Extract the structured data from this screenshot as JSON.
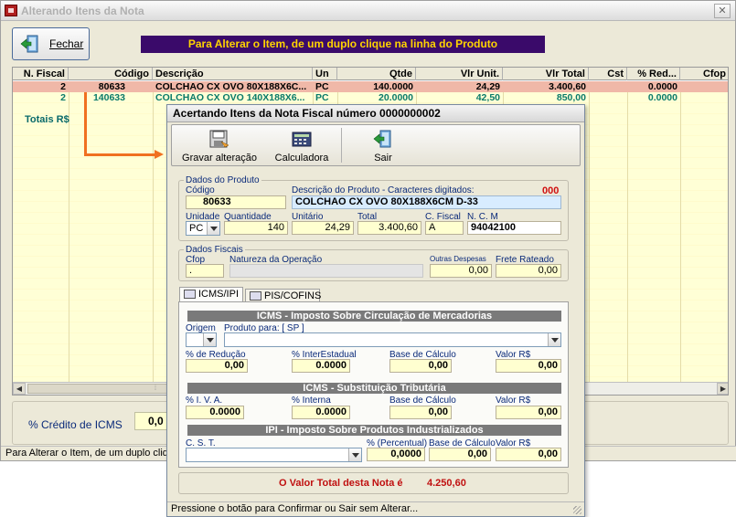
{
  "window": {
    "title": "Alterando Itens da Nota",
    "close_label": "✕"
  },
  "toolbar": {
    "fechar_label": "Fechar"
  },
  "banner": "Para Alterar o Item, de um duplo clique na linha do Produto",
  "grid": {
    "columns": [
      "N. Fiscal",
      "Código",
      "Descrição",
      "Un",
      "Qtde",
      "Vlr Unit.",
      "Vlr Total",
      "Cst",
      "% Red...",
      "Cfop"
    ],
    "rows": [
      [
        "2",
        "80633",
        "COLCHAO CX OVO 80X188X6C...",
        "PC",
        "140.0000",
        "24,29",
        "3.400,60",
        "",
        "0.0000",
        ""
      ],
      [
        "2",
        "140633",
        "COLCHAO CX OVO 140X188X6...",
        "PC",
        "20.0000",
        "42,50",
        "850,00",
        "",
        "0.0000",
        ""
      ]
    ],
    "totais_label": "Totais R$"
  },
  "credito": {
    "label": "% Crédito de ICMS",
    "value": "0,0"
  },
  "statusbar": "Para Alterar o Item, de um duplo cliq",
  "dialog": {
    "title": "Acertando Itens da Nota Fiscal número 0000000002",
    "buttons": {
      "gravar": "Gravar alteração",
      "calculadora": "Calculadora",
      "sair": "Sair"
    },
    "dados_produto": {
      "title": "Dados do Produto",
      "codigo_label": "Código",
      "codigo": "80633",
      "descricao_label": "Descrição do Produto -  Caracteres digitados:",
      "caracteres": "000",
      "descricao": "COLCHAO CX OVO 80X188X6CM D-33",
      "unidade_label": "Unidade",
      "unidade": "PC",
      "quantidade_label": "Quantidade",
      "quantidade": "140",
      "unitario_label": "Unitário",
      "unitario": "24,29",
      "total_label": "Total",
      "total": "3.400,60",
      "cfiscal_label": "C. Fiscal",
      "cfiscal": "A",
      "ncm_label": "N. C. M",
      "ncm": "94042100"
    },
    "dados_fiscais": {
      "title": "Dados Fiscais",
      "cfop_label": "Cfop",
      "cfop": ".",
      "natureza_label": "Natureza da Operação",
      "natureza": "",
      "outras_label": "Outras Despesas",
      "outras": "0,00",
      "frete_label": "Frete Rateado",
      "frete": "0,00"
    },
    "tabs": [
      "ICMS/IPI",
      "PIS/COFINS"
    ],
    "icms": {
      "title": "ICMS - Imposto Sobre Circulação de Mercadorias",
      "origem_label": "Origem",
      "origem": "",
      "produto_para_label": "Produto para: [ SP ]",
      "produto_para": "",
      "reducao_label": "% de Redução",
      "reducao": "0,00",
      "interestadual_label": "% InterEstadual",
      "interestadual": "0.0000",
      "base_label": "Base de Cálculo",
      "base": "0,00",
      "valor_label": "Valor R$",
      "valor": "0,00"
    },
    "st": {
      "title": "ICMS - Substituição Tributária",
      "iva_label": "% I. V. A.",
      "iva": "0.0000",
      "interna_label": "% Interna",
      "interna": "0.0000",
      "base_label": "Base de Cálculo",
      "base": "0,00",
      "valor_label": "Valor R$",
      "valor": "0,00"
    },
    "ipi": {
      "title": "IPI - Imposto Sobre Produtos Industrializados",
      "cst_label": "C. S. T.",
      "cst": "",
      "percentual_label": "% (Percentual)",
      "percentual": "0,0000",
      "base_label": "Base de Cálculo",
      "base": "0,00",
      "valor_label": "Valor R$",
      "valor": "0,00"
    },
    "valor_total_label": "O Valor Total desta Nota é",
    "valor_total": "4.250,60",
    "status": "Pressione o botão para Confirmar ou Sair sem Alterar..."
  }
}
